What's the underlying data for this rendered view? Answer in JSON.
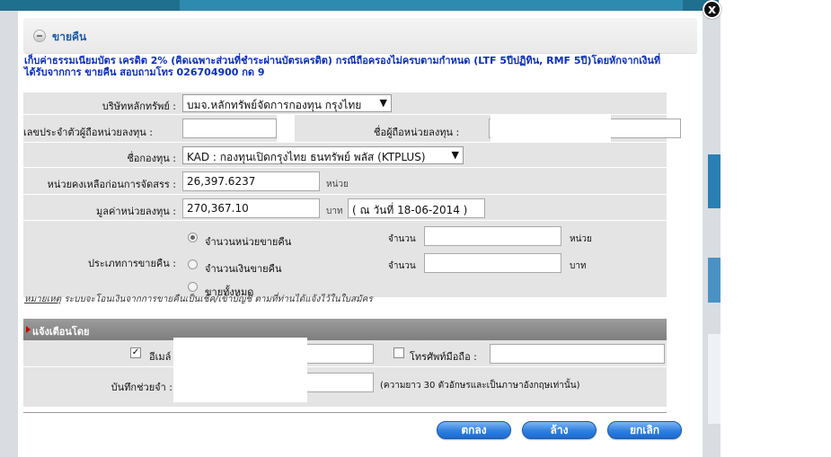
{
  "dialog": {
    "title": "ขายคืน",
    "close_label": "x",
    "notice": "เก็บค่าธรรมเนียมบัตร เครดิต 2% (คิดเฉพาะส่วนที่ชำระผ่านบัตรเครดิต) กรณีถือครองไม่ครบตามกำหนด (LTF 5ปีปฏิทิน, RMF 5ปี)โดยหักจากเงินที่ได้รับจากการ ขายคืน สอบถามโทร 026704900 กด 9"
  },
  "form": {
    "company_label": "บริษัทหลักทรัพย์ :",
    "company_value": "บมจ.หลักทรัพย์จัดการกองทุน กรุงไทย",
    "holder_id_label": "เลขประจำตัวผู้ถือหน่วยลงทุน :",
    "holder_id_value": "",
    "holder_name_label": "ชื่อผู้ถือหน่วยลงทุน :",
    "holder_name_value": "",
    "fund_label": "ชื่อกองทุน :",
    "fund_value": "KAD : กองทุนเปิดกรุงไทย ธนทรัพย์ พลัส (KTPLUS)",
    "units_label": "หน่วยคงเหลือก่อนการจัดสรร :",
    "units_value": "26,397.6237",
    "units_unit": "หน่วย",
    "value_label": "มูลค่าหน่วยลงทุน :",
    "value_value": "270,367.10",
    "value_unit": "บาท",
    "value_date": "( ณ วันที่ 18-06-2014 )",
    "sell_type_label": "ประเภทการขายคืน :",
    "sell_options": [
      {
        "label": "จำนวนหน่วยขายคืน",
        "selected": true,
        "amount_label": "จำนวน",
        "amount_value": "",
        "unit": "หน่วย"
      },
      {
        "label": "จำนวนเงินขายคืน",
        "selected": false,
        "amount_label": "จำนวน",
        "amount_value": "",
        "unit": "บาท"
      },
      {
        "label": "ขายทั้งหมด",
        "selected": false
      }
    ],
    "remark_title": "หมายเหตุ",
    "remark_text": " ระบบจะโอนเงินจากการขายคืนเป็นเช็ค/เข้าบัญชี ตามที่ท่านได้แจ้งไว้ในใบสมัคร"
  },
  "notify": {
    "header": "แจ้งเตือนโดย",
    "email_label": "อีเมล์",
    "email_checked": true,
    "email_value": "",
    "mobile_label": "โทรศัพท์มือถือ :",
    "mobile_checked": false,
    "mobile_value": "",
    "memo_label": "บันทึกช่วยจำ :",
    "memo_value": "",
    "memo_hint": "(ความยาว 30 ตัวอักษรและเป็นภาษาอังกฤษเท่านั้น)"
  },
  "buttons": {
    "ok": "ตกลง",
    "clear": "ล้าง",
    "cancel": "ยกเลิก"
  },
  "colors": {
    "notice_text": "#0a2fb8",
    "title_text": "#1e5ba8",
    "button": "#2e7fe0"
  }
}
